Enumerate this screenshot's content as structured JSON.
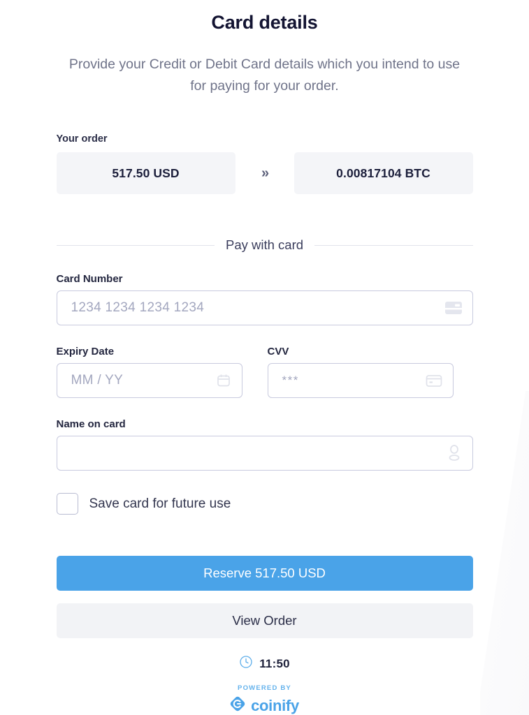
{
  "header": {
    "title": "Card details",
    "subtitle": "Provide your Credit or Debit Card details which you intend to use for paying for your order."
  },
  "order": {
    "label": "Your order",
    "source_amount": "517.50 USD",
    "arrow": "»",
    "target_amount": "0.00817104 BTC"
  },
  "divider": {
    "text": "Pay with card"
  },
  "form": {
    "card_number": {
      "label": "Card Number",
      "placeholder": "1234 1234 1234 1234",
      "value": "",
      "icon": "credit-card-filled-icon"
    },
    "expiry": {
      "label": "Expiry Date",
      "placeholder": "MM / YY",
      "value": "",
      "icon": "calendar-icon"
    },
    "cvv": {
      "label": "CVV",
      "placeholder": "***",
      "value": "",
      "icon": "card-stripe-icon"
    },
    "name_on_card": {
      "label": "Name on card",
      "placeholder": "",
      "value": "",
      "icon": "person-icon"
    },
    "save_card": {
      "label": "Save card for future use",
      "checked": false
    }
  },
  "actions": {
    "reserve_label": "Reserve  517.50 USD",
    "view_order_label": "View Order"
  },
  "footer": {
    "timer": "11:50",
    "timer_icon": "clock-icon",
    "powered_by": "POWERED BY",
    "brand": "coinify",
    "brand_icon": "coinify-logo-icon"
  },
  "colors": {
    "accent": "#4aa3e8",
    "title": "#131432",
    "subtitle": "#6f7389",
    "field_border": "#c8cade",
    "placeholder": "#a3a7bf",
    "amount_bg": "#f4f5f8",
    "secondary_btn_bg": "#f2f3f6"
  }
}
